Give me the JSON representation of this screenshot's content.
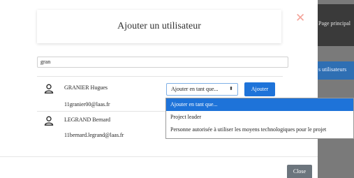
{
  "background_page": {
    "nav_text": "Page principal",
    "active_tab_text": "s utilisateurs"
  },
  "modal": {
    "title": "Ajouter un utilisateur",
    "close_icon": "close-icon",
    "search_value": "gran",
    "users": [
      {
        "name": "GRANIER Hugues",
        "email": "11granier00@laas.fr",
        "icon": "user-icon"
      },
      {
        "name": "LEGRAND Bernard",
        "email": "11bernard.legrand@laas.fr",
        "icon": "user-icon"
      }
    ],
    "role_select": {
      "selected": "Ajouter en tant que...",
      "options": [
        "Ajouter en tant que...",
        "Project leader",
        "Personne autorisée à utiliser les moyens technologiques pour le projet"
      ]
    },
    "add_label": "Ajouter",
    "close_label": "Close",
    "colors": {
      "primary": "#1e73d9",
      "close_x": "#f4a49a",
      "secondary": "#6c757d"
    }
  }
}
